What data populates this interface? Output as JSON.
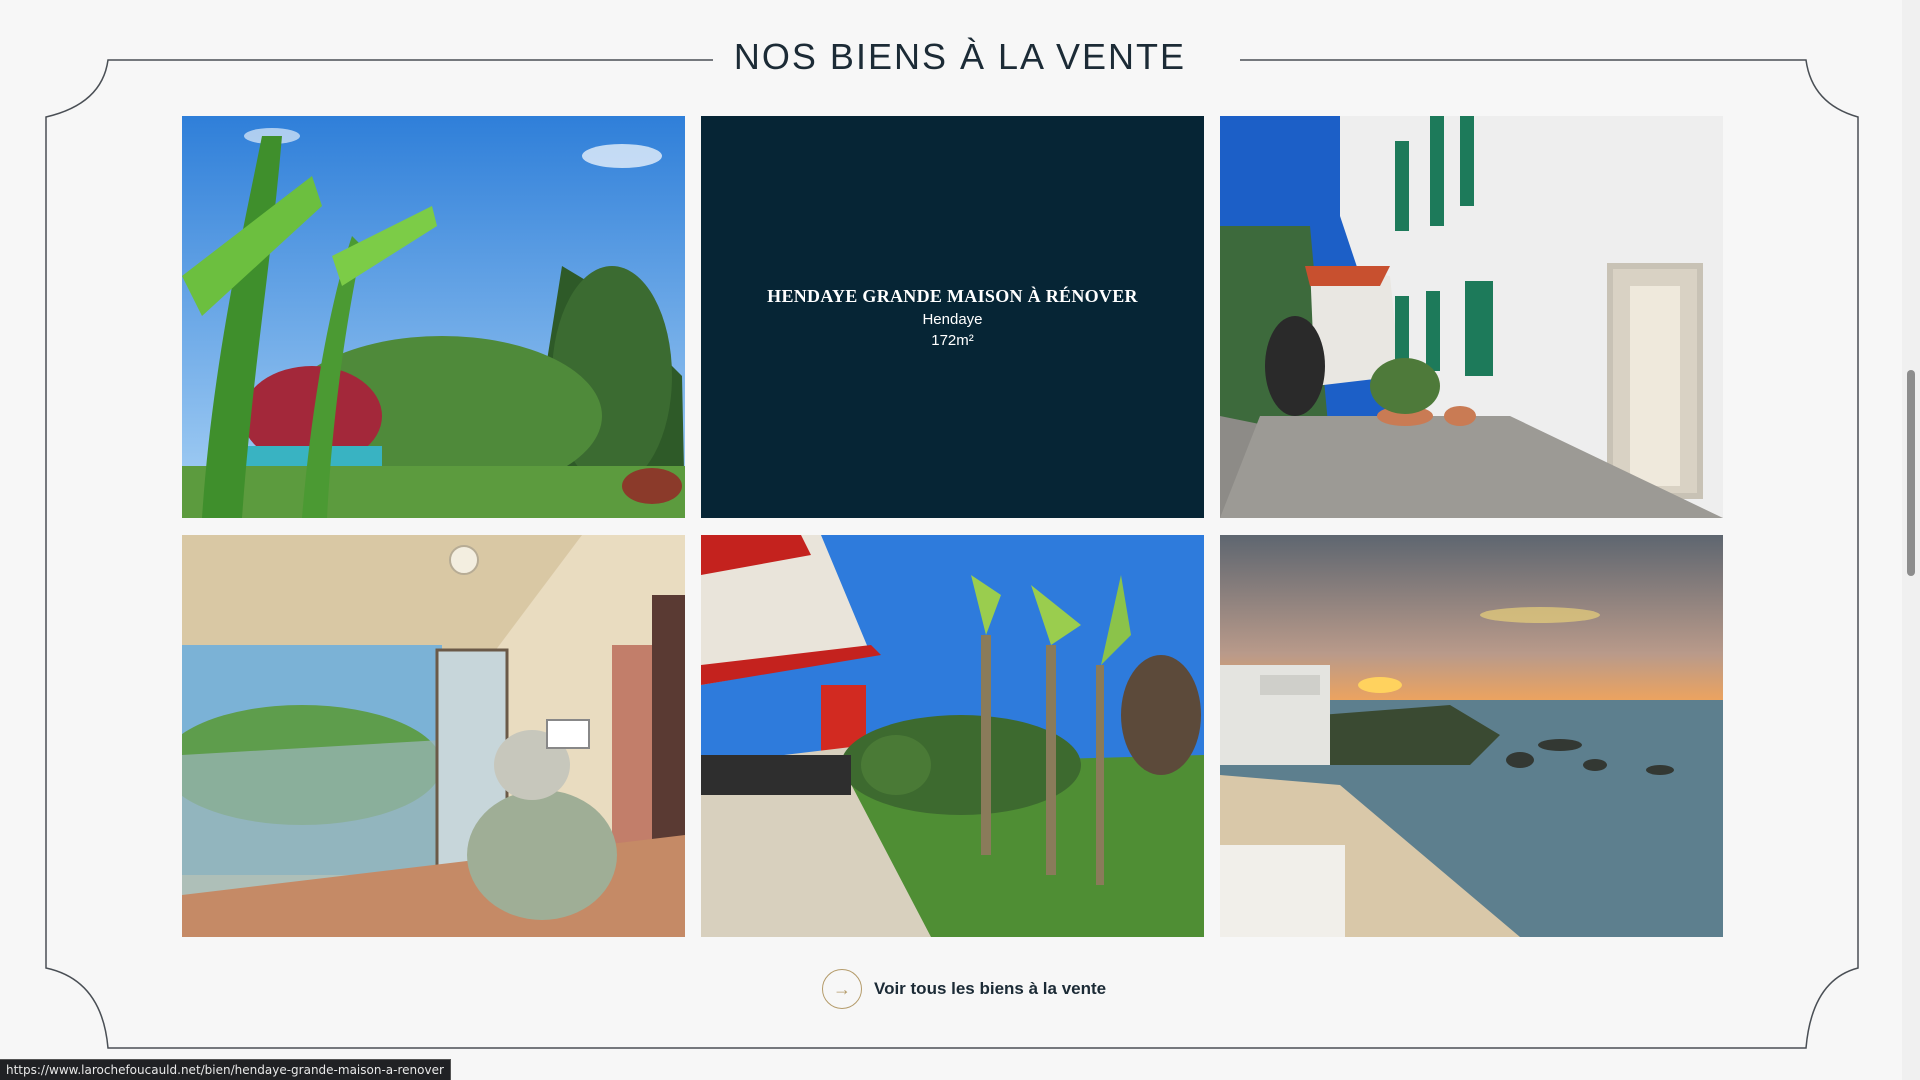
{
  "section": {
    "title": "NOS BIENS À LA VENTE"
  },
  "properties": [
    {
      "kind": "garden-pool-photo"
    },
    {
      "kind": "info-card",
      "title": "HENDAYE GRANDE MAISON À RÉNOVER",
      "city": "Hendaye",
      "area": "172m²"
    },
    {
      "kind": "white-house-photo"
    },
    {
      "kind": "balcony-photo"
    },
    {
      "kind": "terrace-garden-photo"
    },
    {
      "kind": "beach-sunset-photo"
    }
  ],
  "cta": {
    "label": "Voir tous les biens à la vente",
    "icon": "arrow-right-icon"
  },
  "status_url": "https://www.larochefoucauld.net/bien/hendaye-grande-maison-a-renover",
  "colors": {
    "accent": "#b49b6a",
    "card_bg": "#062535",
    "text": "#1c2b36"
  }
}
